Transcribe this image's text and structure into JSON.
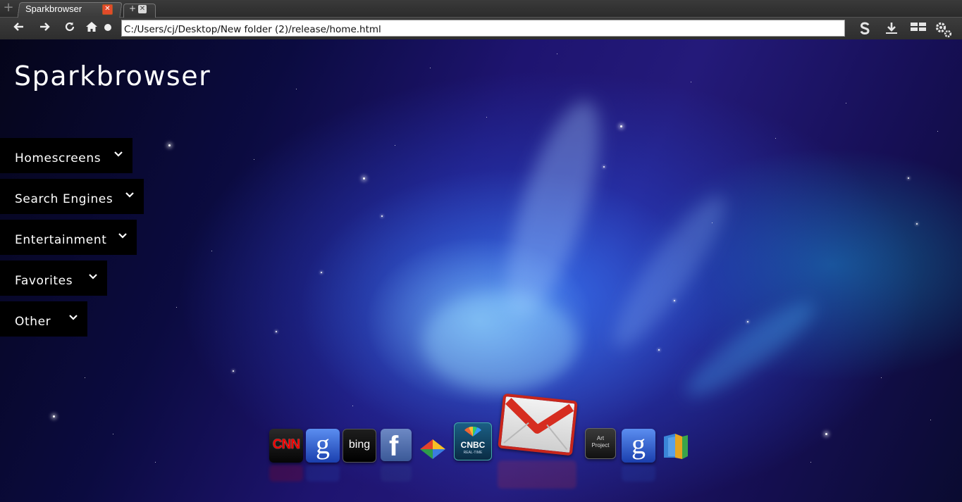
{
  "browser": {
    "tab_title": "Sparkbrowser",
    "tab_close_glyph": "✕",
    "new_tab_glyph": "+",
    "address": "C:/Users/cj/Desktop/New folder (2)/release/home.html",
    "icons": [
      "back-arrow-icon",
      "forward-arrow-icon",
      "reload-icon",
      "home-icon",
      "record-dot-icon",
      "s-extension-icon",
      "download-icon",
      "apps-grid-icon",
      "settings-gears-icon"
    ]
  },
  "page": {
    "logo": "Sparkbrowser",
    "menu": [
      {
        "label": "Homescreens"
      },
      {
        "label": "Search Engines"
      },
      {
        "label": "Entertainment"
      },
      {
        "label": "Favorites"
      },
      {
        "label": "Other"
      }
    ],
    "dock": [
      {
        "name": "cnn",
        "text": "CNN"
      },
      {
        "name": "google",
        "text": "g"
      },
      {
        "name": "bing",
        "text": "bing"
      },
      {
        "name": "facebook",
        "text": "f"
      },
      {
        "name": "google-buzz",
        "text": ""
      },
      {
        "name": "cnbc",
        "text": "CNBC",
        "subtext": "REAL-TIME"
      },
      {
        "name": "gmail",
        "text": ""
      },
      {
        "name": "art-project",
        "text": "Art",
        "subtext": "Project"
      },
      {
        "name": "google-2",
        "text": "g"
      },
      {
        "name": "google-books",
        "text": ""
      }
    ]
  },
  "colors": {
    "chrome_bg": "#2e2e2e",
    "menu_bg": "#000000",
    "tab_close": "#e24a2a",
    "sky_deep": "#0b0b40",
    "aurora_blue": "#46a0ff"
  }
}
